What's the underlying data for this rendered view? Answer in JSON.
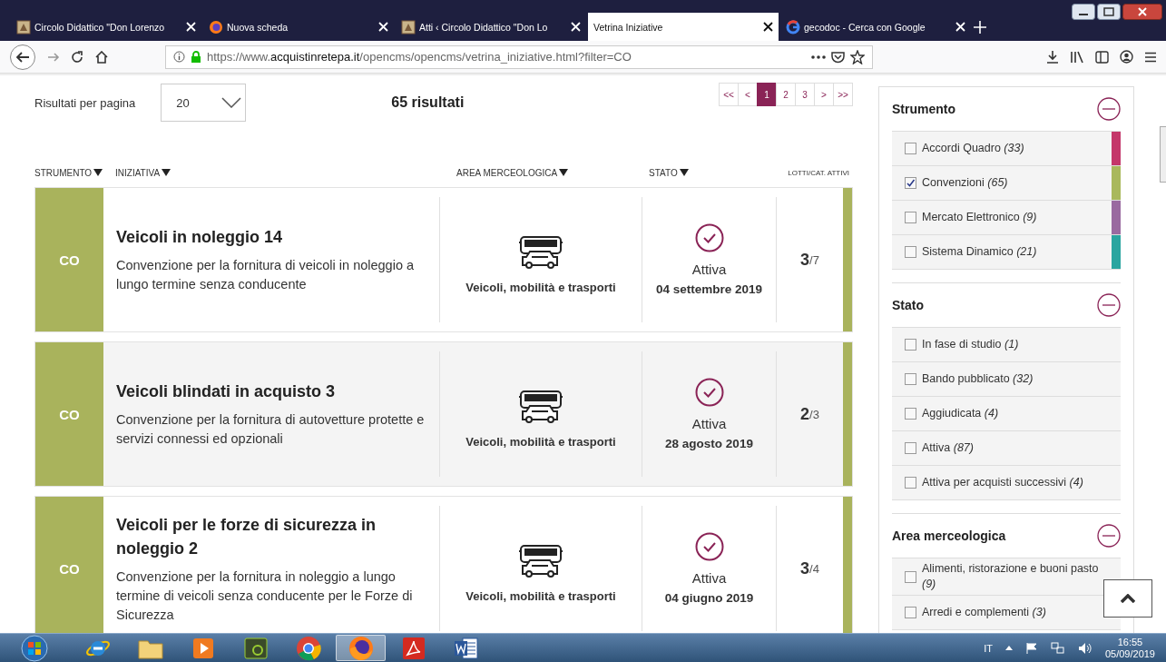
{
  "browser": {
    "tabs": [
      {
        "title": "Circolo Didattico \"Don Lorenzo",
        "selected": false
      },
      {
        "title": "Nuova scheda",
        "selected": false
      },
      {
        "title": "Atti ‹ Circolo Didattico \"Don Lo",
        "selected": false
      },
      {
        "title": "Vetrina Iniziative",
        "selected": true
      },
      {
        "title": "gecodoc - Cerca con Google",
        "selected": false
      }
    ],
    "url": {
      "scheme": "https://www.",
      "domain": "acquistinretepa.it",
      "path": "/opencms/opencms/vetrina_iniziative.html?filter=CO"
    }
  },
  "toolbar": {
    "per_page_label": "Risultati per pagina",
    "per_page_value": "20",
    "results_count": "65 risultati"
  },
  "pagination": [
    {
      "label": "<<",
      "selected": false
    },
    {
      "label": "<",
      "selected": false
    },
    {
      "label": "1",
      "selected": true
    },
    {
      "label": "2",
      "selected": false
    },
    {
      "label": "3",
      "selected": false
    },
    {
      "label": ">",
      "selected": false
    },
    {
      "label": ">>",
      "selected": false
    }
  ],
  "table": {
    "columns": [
      {
        "label": "STRUMENTO",
        "sortable": true
      },
      {
        "label": "INIZIATIVA",
        "sortable": true
      },
      {
        "label": "AREA MERCEOLOGICA",
        "sortable": true
      },
      {
        "label": "STATO",
        "sortable": true
      },
      {
        "label": "LOTTI/CAT. ATTIVI",
        "sortable": false
      }
    ],
    "rows": [
      {
        "code": "CO",
        "color": "#a9b35c",
        "title": "Veicoli in noleggio 14",
        "description": "Convenzione per la fornitura di veicoli in noleggio a lungo termine senza conducente",
        "area": "Veicoli, mobilità e trasporti",
        "status": "Attiva",
        "date": "04 settembre 2019",
        "active_lots": "3",
        "total_lots": "/7"
      },
      {
        "code": "CO",
        "color": "#a9b35c",
        "title": "Veicoli blindati in acquisto 3",
        "description": "Convenzione per la fornitura di autovetture protette e servizi connessi ed opzionali",
        "area": "Veicoli, mobilità e trasporti",
        "status": "Attiva",
        "date": "28 agosto 2019",
        "active_lots": "2",
        "total_lots": "/3"
      },
      {
        "code": "CO",
        "color": "#a9b35c",
        "title": "Veicoli per le forze di sicurezza in noleggio 2",
        "description": "Convenzione per la fornitura in noleggio a lungo termine di veicoli senza conducente per le Forze di Sicurezza",
        "area": "Veicoli, mobilità e trasporti",
        "status": "Attiva",
        "date": "04 giugno 2019",
        "active_lots": "3",
        "total_lots": "/4"
      }
    ]
  },
  "filters": [
    {
      "title": "Strumento",
      "expanded": true,
      "items": [
        {
          "label": "Accordi Quadro *(33)*",
          "checked": false,
          "color": "#c4376a"
        },
        {
          "label": "Convenzioni *(65)*",
          "checked": true,
          "color": "#a9b85c"
        },
        {
          "label": "Mercato Elettronico *(9)*",
          "checked": false,
          "color": "#9a6aa0"
        },
        {
          "label": "Sistema Dinamico *(21)*",
          "checked": false,
          "color": "#2aa5a0"
        }
      ]
    },
    {
      "title": "Stato",
      "expanded": true,
      "items": [
        {
          "label": "In fase di studio *(1)*",
          "checked": false
        },
        {
          "label": "Bando pubblicato *(32)*",
          "checked": false
        },
        {
          "label": "Aggiudicata *(4)*",
          "checked": false
        },
        {
          "label": "Attiva *(87)*",
          "checked": false
        },
        {
          "label": "Attiva per acquisti successivi *(4)*",
          "checked": false
        }
      ]
    },
    {
      "title": "Area merceologica",
      "expanded": true,
      "items": [
        {
          "label": "Alimenti, ristorazione e buoni pasto *(9)*",
          "checked": false
        },
        {
          "label": "Arredi e complementi *(3)*",
          "checked": false
        }
      ]
    }
  ],
  "taskbar": {
    "apps": [
      {
        "selected": false
      },
      {
        "selected": false
      },
      {
        "selected": false
      },
      {
        "selected": false
      },
      {
        "selected": false
      },
      {
        "selected": true
      },
      {
        "selected": false
      },
      {
        "selected": false
      }
    ],
    "language": "IT",
    "time": "16:55",
    "date": "05/09/2019"
  }
}
